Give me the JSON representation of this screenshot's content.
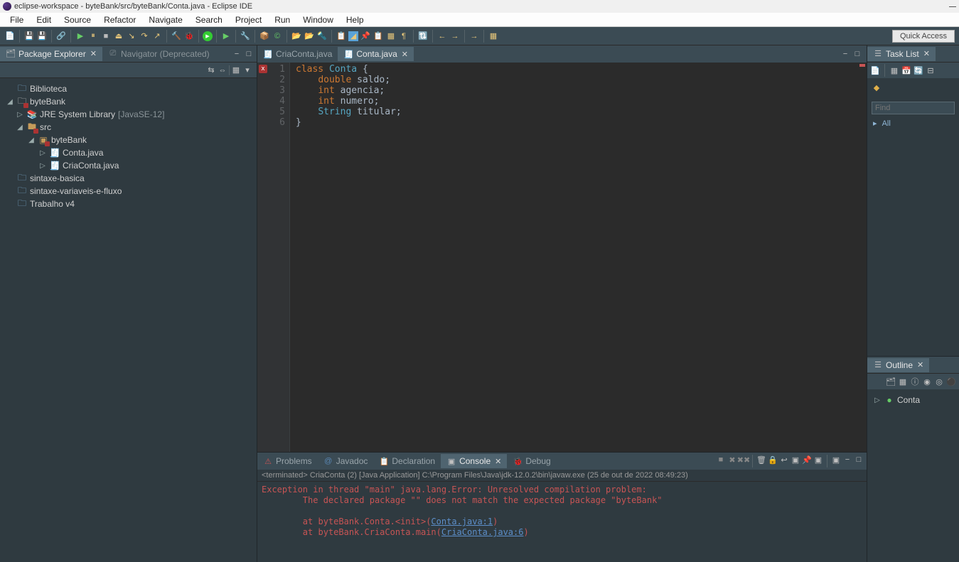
{
  "window": {
    "title": "eclipse-workspace - byteBank/src/byteBank/Conta.java - Eclipse IDE"
  },
  "menu": [
    "File",
    "Edit",
    "Source",
    "Refactor",
    "Navigate",
    "Search",
    "Project",
    "Run",
    "Window",
    "Help"
  ],
  "quick_access": "Quick Access",
  "explorer": {
    "tabs": {
      "active": "Package Explorer",
      "inactive": "Navigator (Deprecated)"
    },
    "tree": {
      "biblioteca": "Biblioteca",
      "bytebank": "byteBank",
      "jre": "JRE System Library",
      "jre_suffix": "[JavaSE-12]",
      "src": "src",
      "pkg": "byteBank",
      "conta": "Conta.java",
      "criaconta": "CriaConta.java",
      "sintaxe_basica": "sintaxe-basica",
      "sintaxe_var": "sintaxe-variaveis-e-fluxo",
      "trabalho": "Trabalho v4"
    }
  },
  "editor": {
    "tab_inactive": "CriaConta.java",
    "tab_active": "Conta.java",
    "code": {
      "l1_kw": "class",
      "l1_name": "Conta",
      "l1_brace": "{",
      "l2_ty": "double",
      "l2_id": "saldo;",
      "l3_ty": "int",
      "l3_id": "agencia;",
      "l4_ty": "int",
      "l4_id": "numero;",
      "l5_ty": "String",
      "l5_id": "titular;",
      "l6": "}"
    },
    "lines": [
      "1",
      "2",
      "3",
      "4",
      "5",
      "6"
    ]
  },
  "tasklist": {
    "title": "Task List",
    "find_placeholder": "Find",
    "all_label": "All"
  },
  "outline": {
    "title": "Outline",
    "item": "Conta"
  },
  "bottom": {
    "tabs": {
      "problems": "Problems",
      "javadoc": "Javadoc",
      "declaration": "Declaration",
      "console": "Console",
      "debug": "Debug"
    },
    "subtitle": "<terminated> CriaConta (2) [Java Application] C:\\Program Files\\Java\\jdk-12.0.2\\bin\\javaw.exe (25 de out de 2022 08:49:23)",
    "lines": {
      "l1": "Exception in thread \"main\" java.lang.Error: Unresolved compilation problem: ",
      "l2": "        The declared package \"\" does not match the expected package \"byteBank\"",
      "l3": "",
      "l4a": "        at byteBank.Conta.<init>(",
      "l4link": "Conta.java:1",
      "l4b": ")",
      "l5a": "        at byteBank.CriaConta.main(",
      "l5link": "CriaConta.java:6",
      "l5b": ")"
    }
  }
}
